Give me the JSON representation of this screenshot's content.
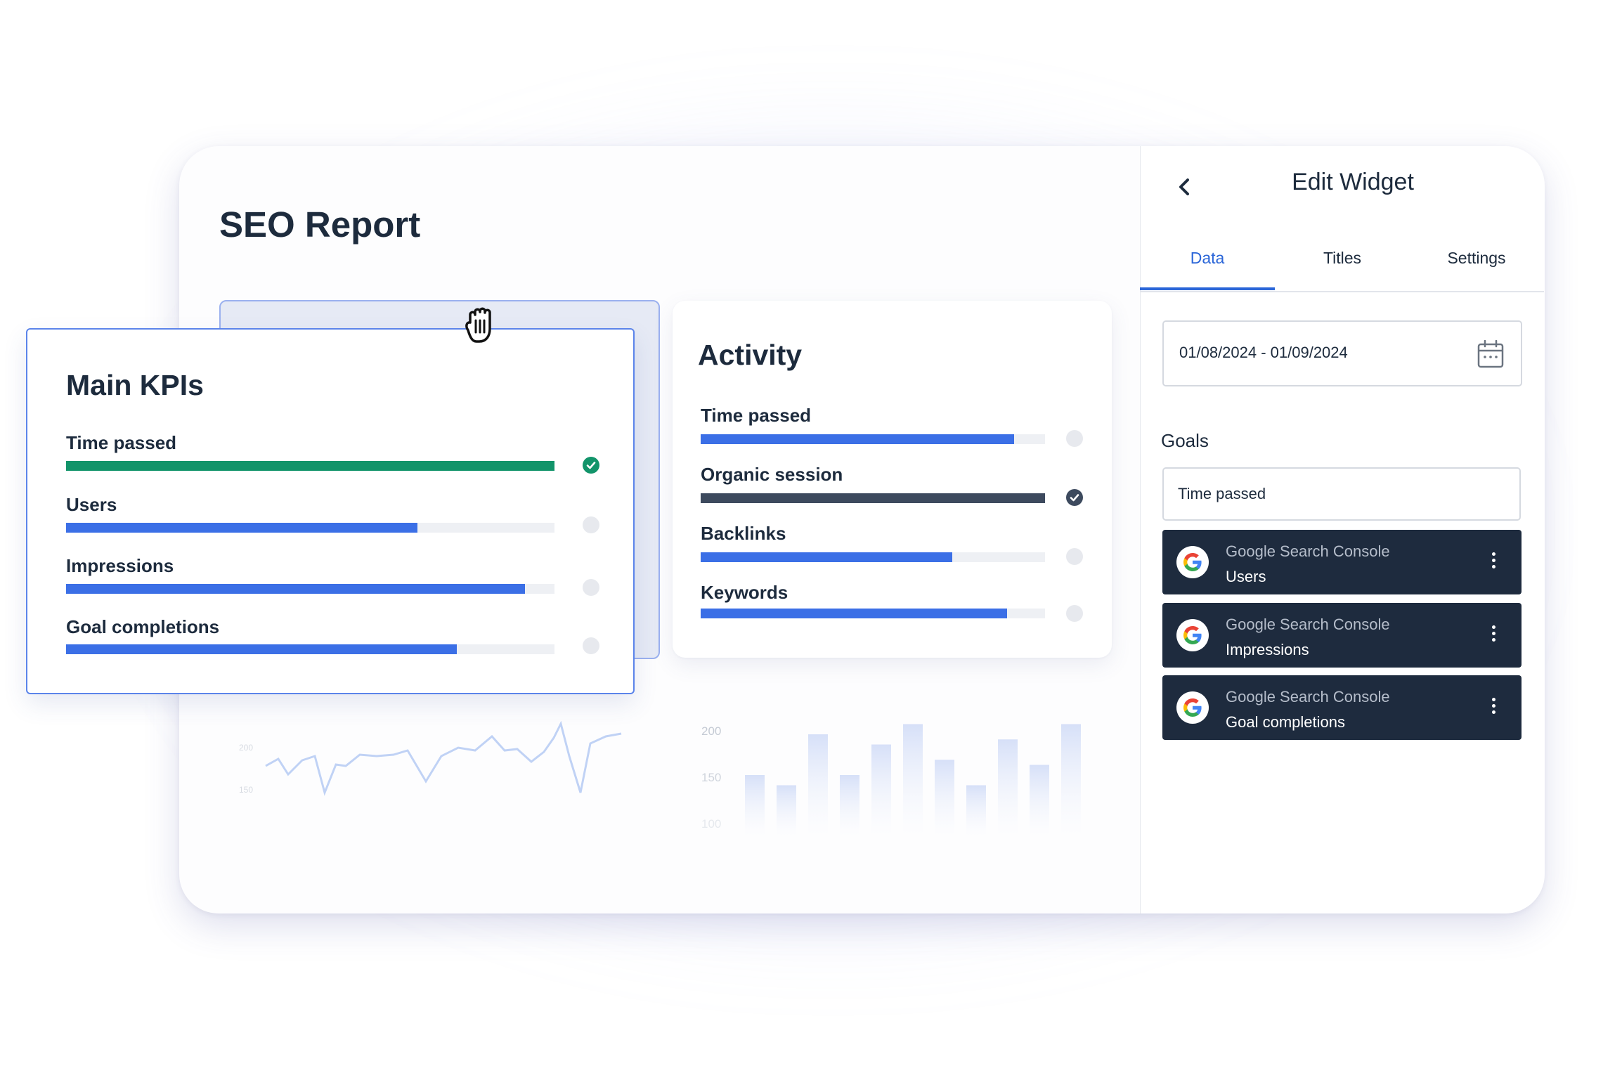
{
  "report": {
    "title": "SEO Report"
  },
  "main_kpis": {
    "title": "Main KPIs",
    "rows": [
      {
        "label": "Time passed",
        "progress": 1.0,
        "status": "complete",
        "color": "#12946a"
      },
      {
        "label": "Users",
        "progress": 0.72,
        "status": "pending",
        "color": "#3b6fe6"
      },
      {
        "label": "Impressions",
        "progress": 0.94,
        "status": "pending",
        "color": "#3b6fe6"
      },
      {
        "label": "Goal completions",
        "progress": 0.8,
        "status": "pending",
        "color": "#3b6fe6"
      }
    ]
  },
  "activity": {
    "title": "Activity",
    "rows": [
      {
        "label": "Time passed",
        "progress": 0.91,
        "status": "pending",
        "color": "#3b6fe6"
      },
      {
        "label": "Organic session",
        "progress": 1.0,
        "status": "complete",
        "color": "#3d4a5e"
      },
      {
        "label": "Backlinks",
        "progress": 0.73,
        "status": "pending",
        "color": "#3b6fe6"
      },
      {
        "label": "Keywords",
        "progress": 0.89,
        "status": "pending",
        "color": "#3b6fe6"
      }
    ]
  },
  "faded_line_chart": {
    "y_ticks": [
      "200",
      "150"
    ]
  },
  "faded_bar_chart": {
    "y_ticks": [
      "200",
      "150",
      "100"
    ],
    "values": [
      160,
      150,
      200,
      160,
      190,
      210,
      175,
      150,
      195,
      170,
      210
    ]
  },
  "edit_widget": {
    "back_icon": "chevron-left-icon",
    "title": "Edit Widget",
    "tabs": [
      {
        "label": "Data",
        "active": true
      },
      {
        "label": "Titles",
        "active": false
      },
      {
        "label": "Settings",
        "active": false
      }
    ],
    "date_range": {
      "value": "01/08/2024 - 01/09/2024",
      "icon": "calendar-icon"
    },
    "goals": {
      "label": "Goals",
      "input_value": "Time passed",
      "sources": [
        {
          "name": "Google Search Console",
          "metric": "Users",
          "icon": "google-icon"
        },
        {
          "name": "Google Search Console",
          "metric": "Impressions",
          "icon": "google-icon"
        },
        {
          "name": "Google Search Console",
          "metric": "Goal completions",
          "icon": "google-icon"
        }
      ]
    }
  },
  "colors": {
    "accent": "#2b66d8",
    "bar_blue": "#3b6fe6",
    "success_green": "#12946a",
    "dark_navy": "#1e2b3e"
  },
  "cursor_icon": "grab-hand-icon"
}
